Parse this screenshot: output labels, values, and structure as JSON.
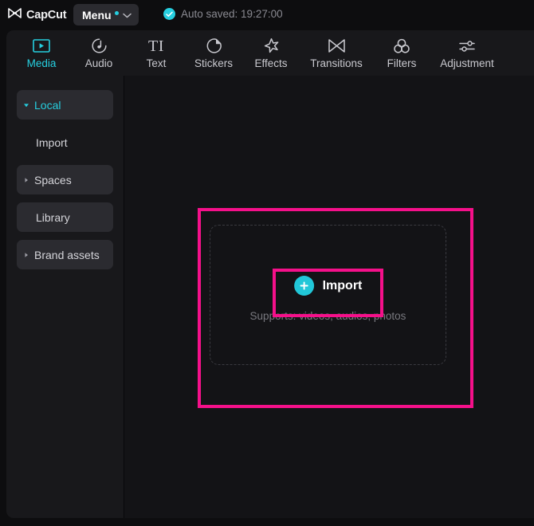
{
  "app": {
    "name": "CapCut",
    "logo_icon": "capcut-logo-icon"
  },
  "titlebar": {
    "menu": {
      "label": "Menu",
      "badge_dot": true,
      "chevron_icon": "chevron-down-icon"
    },
    "autosave": {
      "status_icon": "check-circle-icon",
      "text": "Auto saved: 19:27:00"
    }
  },
  "tabs": [
    {
      "label": "Media",
      "icon": "media-play-rect-icon",
      "active": true
    },
    {
      "label": "Audio",
      "icon": "audio-note-icon",
      "active": false
    },
    {
      "label": "Text",
      "icon": "text-ti-icon",
      "active": false
    },
    {
      "label": "Stickers",
      "icon": "sticker-folded-circle-icon",
      "active": false
    },
    {
      "label": "Effects",
      "icon": "effects-sparkle-icon",
      "active": false
    },
    {
      "label": "Transitions",
      "icon": "transitions-bowtie-icon",
      "active": false
    },
    {
      "label": "Filters",
      "icon": "filters-circles-icon",
      "active": false
    },
    {
      "label": "Adjustment",
      "icon": "adjustment-sliders-icon",
      "active": false
    }
  ],
  "sidebar": {
    "items": [
      {
        "label": "Local",
        "arrow": "expanded",
        "boxed": true,
        "active": true,
        "sub": false
      },
      {
        "label": "Import",
        "arrow": "none",
        "boxed": false,
        "active": false,
        "sub": true
      },
      {
        "label": "Spaces",
        "arrow": "collapsed",
        "boxed": true,
        "active": false,
        "sub": false
      },
      {
        "label": "Library",
        "arrow": "none",
        "boxed": true,
        "active": false,
        "sub": true
      },
      {
        "label": "Brand assets",
        "arrow": "collapsed",
        "boxed": true,
        "active": false,
        "sub": false
      }
    ]
  },
  "media_panel": {
    "import_button": {
      "label": "Import",
      "plus_icon": "plus-circle-icon"
    },
    "supports_text": "Supports: videos, audios, photos"
  },
  "annotations": {
    "highlight_color": "#f5108a",
    "boxes": [
      {
        "name": "dropzone-highlight"
      },
      {
        "name": "import-button-highlight"
      }
    ]
  },
  "colors": {
    "accent": "#26cfe0",
    "panel": "#18181b",
    "window": "#0d0d0f",
    "media_bg": "#131316",
    "highlight": "#f5108a"
  }
}
